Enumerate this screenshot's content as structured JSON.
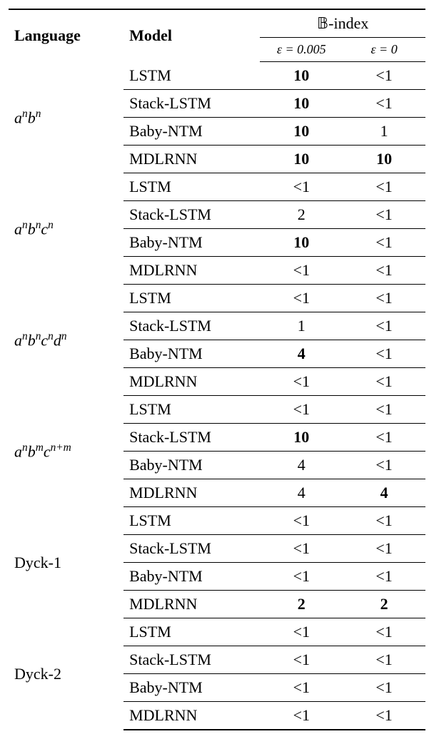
{
  "header": {
    "language": "Language",
    "model": "Model",
    "bindex": "𝔹-index",
    "eps1": "ε = 0.005",
    "eps2": "ε = 0"
  },
  "chart_data": {
    "type": "table",
    "title": "𝔹-index results by Language and Model",
    "columns": [
      "Language",
      "Model",
      "ε = 0.005",
      "ε = 0"
    ],
    "groups": [
      {
        "language_html": "<span class='math'>a</span><span class='sup'>n</span><span class='math'>b</span><span class='sup'>n</span>",
        "rows": [
          {
            "model": "LSTM",
            "v1": "10",
            "v1_bold": true,
            "v2": "<1",
            "v2_bold": false
          },
          {
            "model": "Stack-LSTM",
            "v1": "10",
            "v1_bold": true,
            "v2": "<1",
            "v2_bold": false
          },
          {
            "model": "Baby-NTM",
            "v1": "10",
            "v1_bold": true,
            "v2": "1",
            "v2_bold": false
          },
          {
            "model": "MDLRNN",
            "v1": "10",
            "v1_bold": true,
            "v2": "10",
            "v2_bold": true
          }
        ]
      },
      {
        "language_html": "<span class='math'>a</span><span class='sup'>n</span><span class='math'>b</span><span class='sup'>n</span><span class='math'>c</span><span class='sup'>n</span>",
        "rows": [
          {
            "model": "LSTM",
            "v1": "<1",
            "v1_bold": false,
            "v2": "<1",
            "v2_bold": false
          },
          {
            "model": "Stack-LSTM",
            "v1": "2",
            "v1_bold": false,
            "v2": "<1",
            "v2_bold": false
          },
          {
            "model": "Baby-NTM",
            "v1": "10",
            "v1_bold": true,
            "v2": "<1",
            "v2_bold": false
          },
          {
            "model": "MDLRNN",
            "v1": "<1",
            "v1_bold": false,
            "v2": "<1",
            "v2_bold": false
          }
        ]
      },
      {
        "language_html": "<span class='math'>a</span><span class='sup'>n</span><span class='math'>b</span><span class='sup'>n</span><span class='math'>c</span><span class='sup'>n</span><span class='math'>d</span><span class='sup'>n</span>",
        "rows": [
          {
            "model": "LSTM",
            "v1": "<1",
            "v1_bold": false,
            "v2": "<1",
            "v2_bold": false
          },
          {
            "model": "Stack-LSTM",
            "v1": "1",
            "v1_bold": false,
            "v2": "<1",
            "v2_bold": false
          },
          {
            "model": "Baby-NTM",
            "v1": "4",
            "v1_bold": true,
            "v2": "<1",
            "v2_bold": false
          },
          {
            "model": "MDLRNN",
            "v1": "<1",
            "v1_bold": false,
            "v2": "<1",
            "v2_bold": false
          }
        ]
      },
      {
        "language_html": "<span class='math'>a</span><span class='sup'>n</span><span class='math'>b</span><span class='sup'>m</span><span class='math'>c</span><span class='sup'>n+m</span>",
        "rows": [
          {
            "model": "LSTM",
            "v1": "<1",
            "v1_bold": false,
            "v2": "<1",
            "v2_bold": false
          },
          {
            "model": "Stack-LSTM",
            "v1": "10",
            "v1_bold": true,
            "v2": "<1",
            "v2_bold": false
          },
          {
            "model": "Baby-NTM",
            "v1": "4",
            "v1_bold": false,
            "v2": "<1",
            "v2_bold": false
          },
          {
            "model": "MDLRNN",
            "v1": "4",
            "v1_bold": false,
            "v2": "4",
            "v2_bold": true
          }
        ]
      },
      {
        "language_html": "Dyck-1",
        "rows": [
          {
            "model": "LSTM",
            "v1": "<1",
            "v1_bold": false,
            "v2": "<1",
            "v2_bold": false
          },
          {
            "model": "Stack-LSTM",
            "v1": "<1",
            "v1_bold": false,
            "v2": "<1",
            "v2_bold": false
          },
          {
            "model": "Baby-NTM",
            "v1": "<1",
            "v1_bold": false,
            "v2": "<1",
            "v2_bold": false
          },
          {
            "model": "MDLRNN",
            "v1": "2",
            "v1_bold": true,
            "v2": "2",
            "v2_bold": true
          }
        ]
      },
      {
        "language_html": "Dyck-2",
        "rows": [
          {
            "model": "LSTM",
            "v1": "<1",
            "v1_bold": false,
            "v2": "<1",
            "v2_bold": false
          },
          {
            "model": "Stack-LSTM",
            "v1": "<1",
            "v1_bold": false,
            "v2": "<1",
            "v2_bold": false
          },
          {
            "model": "Baby-NTM",
            "v1": "<1",
            "v1_bold": false,
            "v2": "<1",
            "v2_bold": false
          },
          {
            "model": "MDLRNN",
            "v1": "<1",
            "v1_bold": false,
            "v2": "<1",
            "v2_bold": false
          }
        ]
      }
    ]
  }
}
